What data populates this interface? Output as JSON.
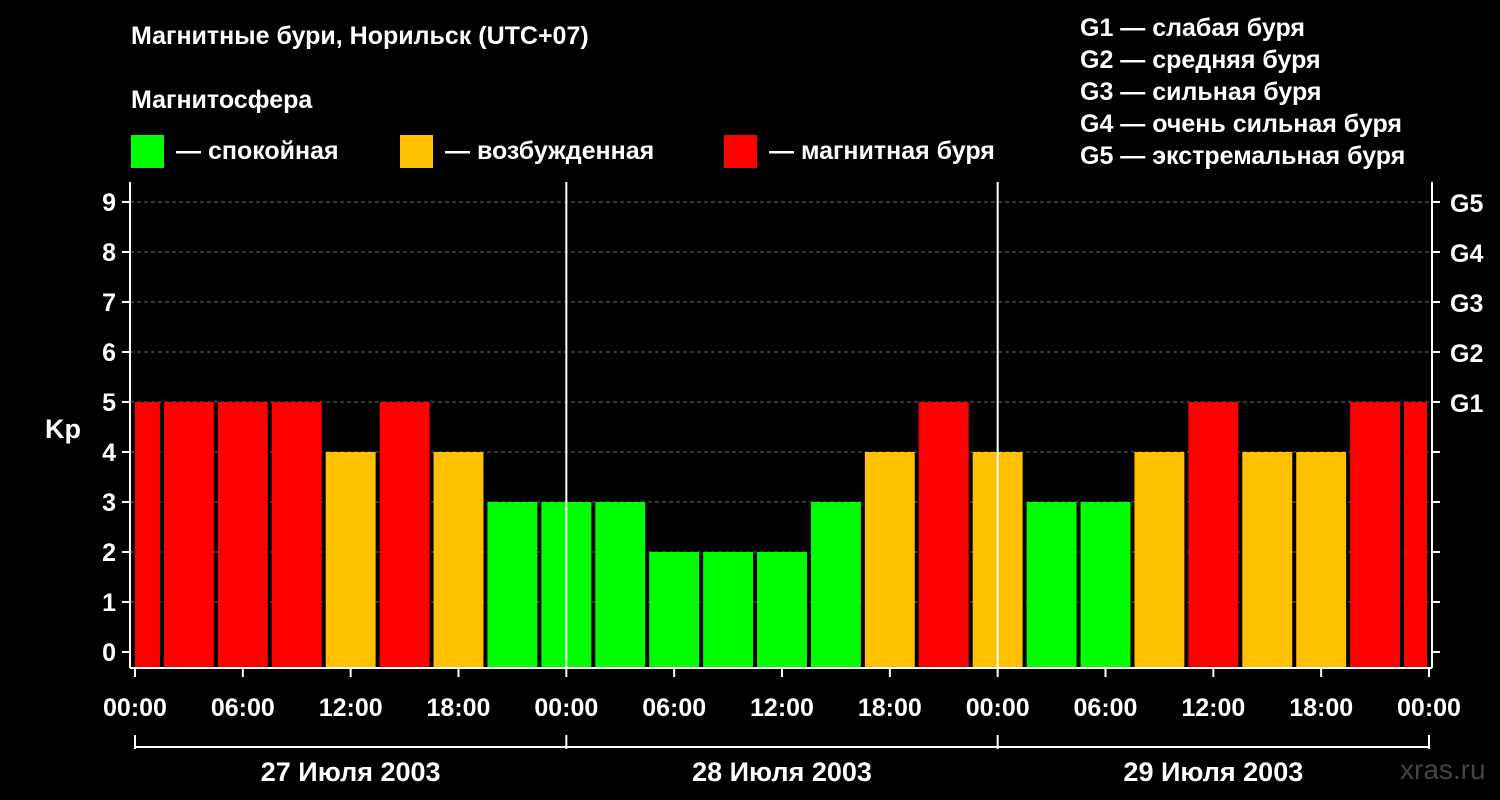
{
  "header": {
    "title": "Магнитные бури, Норильск (UTC+07)",
    "subtitle": "Магнитосфера"
  },
  "legend": [
    {
      "label": "— спокойная",
      "color": "#00ff00"
    },
    {
      "label": "— возбужденная",
      "color": "#ffc000"
    },
    {
      "label": "— магнитная буря",
      "color": "#ff0000"
    }
  ],
  "g_legend": [
    "G1 — слабая буря",
    "G2 — средняя буря",
    "G3 — сильная буря",
    "G4 — очень сильная буря",
    "G5 — экстремальная буря"
  ],
  "watermark": "xras.ru",
  "chart_data": {
    "type": "bar",
    "title": "Магнитные бури, Норильск (UTC+07)",
    "ylabel": "Kp",
    "ylim": [
      0,
      9
    ],
    "yticks": [
      0,
      1,
      2,
      3,
      4,
      5,
      6,
      7,
      8,
      9
    ],
    "right_ticks": [
      {
        "value": 5,
        "label": "G1"
      },
      {
        "value": 6,
        "label": "G2"
      },
      {
        "value": 7,
        "label": "G3"
      },
      {
        "value": 8,
        "label": "G4"
      },
      {
        "value": 9,
        "label": "G5"
      }
    ],
    "x_tick_labels": [
      "00:00",
      "06:00",
      "12:00",
      "18:00",
      "00:00",
      "06:00",
      "12:00",
      "18:00",
      "00:00",
      "06:00",
      "12:00",
      "18:00",
      "00:00"
    ],
    "dates": [
      "27 Июля 2003",
      "28 Июля 2003",
      "29 Июля 2003"
    ],
    "colors": {
      "quiet": "#00ff00",
      "active": "#ffc000",
      "storm": "#ff0000"
    },
    "bars": [
      {
        "start_hour": 0,
        "end_hour": 1.5,
        "kp": 5,
        "level": "storm"
      },
      {
        "start_hour": 1.5,
        "end_hour": 4.5,
        "kp": 5,
        "level": "storm"
      },
      {
        "start_hour": 4.5,
        "end_hour": 7.5,
        "kp": 5,
        "level": "storm"
      },
      {
        "start_hour": 7.5,
        "end_hour": 10.5,
        "kp": 5,
        "level": "storm"
      },
      {
        "start_hour": 10.5,
        "end_hour": 13.5,
        "kp": 4,
        "level": "active"
      },
      {
        "start_hour": 13.5,
        "end_hour": 16.5,
        "kp": 5,
        "level": "storm"
      },
      {
        "start_hour": 16.5,
        "end_hour": 19.5,
        "kp": 4,
        "level": "active"
      },
      {
        "start_hour": 19.5,
        "end_hour": 22.5,
        "kp": 3,
        "level": "quiet"
      },
      {
        "start_hour": 22.5,
        "end_hour": 25.5,
        "kp": 3,
        "level": "quiet"
      },
      {
        "start_hour": 25.5,
        "end_hour": 28.5,
        "kp": 3,
        "level": "quiet"
      },
      {
        "start_hour": 28.5,
        "end_hour": 31.5,
        "kp": 2,
        "level": "quiet"
      },
      {
        "start_hour": 31.5,
        "end_hour": 34.5,
        "kp": 2,
        "level": "quiet"
      },
      {
        "start_hour": 34.5,
        "end_hour": 37.5,
        "kp": 2,
        "level": "quiet"
      },
      {
        "start_hour": 37.5,
        "end_hour": 40.5,
        "kp": 3,
        "level": "quiet"
      },
      {
        "start_hour": 40.5,
        "end_hour": 43.5,
        "kp": 4,
        "level": "active"
      },
      {
        "start_hour": 43.5,
        "end_hour": 46.5,
        "kp": 5,
        "level": "storm"
      },
      {
        "start_hour": 46.5,
        "end_hour": 49.5,
        "kp": 4,
        "level": "active"
      },
      {
        "start_hour": 49.5,
        "end_hour": 52.5,
        "kp": 3,
        "level": "quiet"
      },
      {
        "start_hour": 52.5,
        "end_hour": 55.5,
        "kp": 3,
        "level": "quiet"
      },
      {
        "start_hour": 55.5,
        "end_hour": 58.5,
        "kp": 4,
        "level": "active"
      },
      {
        "start_hour": 58.5,
        "end_hour": 61.5,
        "kp": 5,
        "level": "storm"
      },
      {
        "start_hour": 61.5,
        "end_hour": 64.5,
        "kp": 4,
        "level": "active"
      },
      {
        "start_hour": 64.5,
        "end_hour": 67.5,
        "kp": 4,
        "level": "active"
      },
      {
        "start_hour": 67.5,
        "end_hour": 70.5,
        "kp": 5,
        "level": "storm"
      },
      {
        "start_hour": 70.5,
        "end_hour": 72,
        "kp": 5,
        "level": "storm"
      }
    ]
  }
}
